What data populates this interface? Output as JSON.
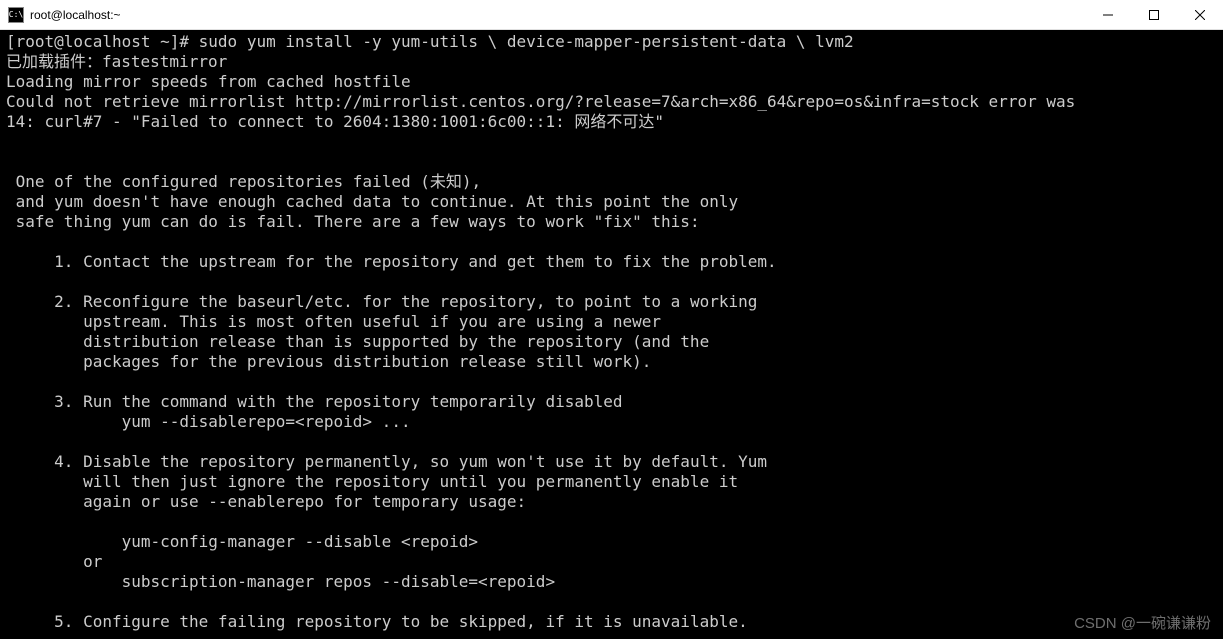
{
  "titlebar": {
    "icon_label": "C:\\",
    "title": "root@localhost:~"
  },
  "window_controls": {
    "minimize": "minimize",
    "maximize": "maximize",
    "close": "close"
  },
  "terminal": {
    "prompt": "[root@localhost ~]# ",
    "command": "sudo yum install -y yum-utils \\ device-mapper-persistent-data \\ lvm2",
    "lines": [
      "已加载插件：fastestmirror",
      "Loading mirror speeds from cached hostfile",
      "Could not retrieve mirrorlist http://mirrorlist.centos.org/?release=7&arch=x86_64&repo=os&infra=stock error was",
      "14: curl#7 - \"Failed to connect to 2604:1380:1001:6c00::1: 网络不可达\"",
      "",
      "",
      " One of the configured repositories failed (未知),",
      " and yum doesn't have enough cached data to continue. At this point the only",
      " safe thing yum can do is fail. There are a few ways to work \"fix\" this:",
      "",
      "     1. Contact the upstream for the repository and get them to fix the problem.",
      "",
      "     2. Reconfigure the baseurl/etc. for the repository, to point to a working",
      "        upstream. This is most often useful if you are using a newer",
      "        distribution release than is supported by the repository (and the",
      "        packages for the previous distribution release still work).",
      "",
      "     3. Run the command with the repository temporarily disabled",
      "            yum --disablerepo=<repoid> ...",
      "",
      "     4. Disable the repository permanently, so yum won't use it by default. Yum",
      "        will then just ignore the repository until you permanently enable it",
      "        again or use --enablerepo for temporary usage:",
      "",
      "            yum-config-manager --disable <repoid>",
      "        or",
      "            subscription-manager repos --disable=<repoid>",
      "",
      "     5. Configure the failing repository to be skipped, if it is unavailable."
    ]
  },
  "watermark": "CSDN @一碗谦谦粉"
}
